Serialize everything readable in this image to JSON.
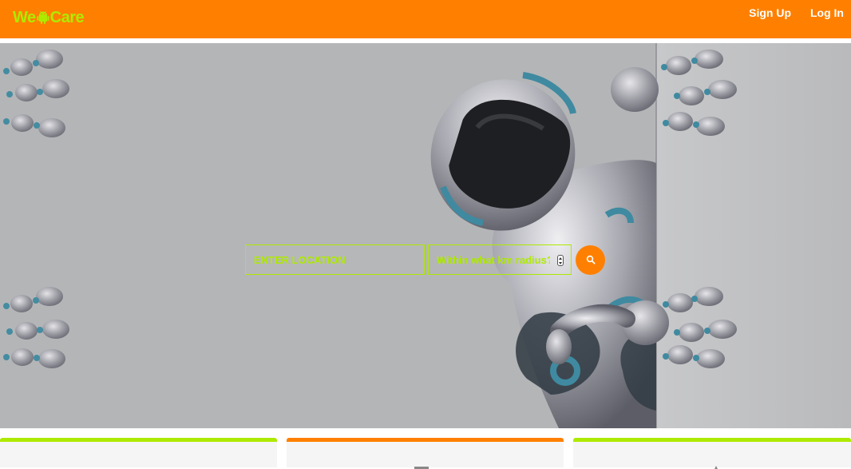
{
  "navbar": {
    "brand": {
      "prefix": "We",
      "suffix": "Care",
      "icon": "android-icon"
    },
    "links": [
      {
        "label": "Sign Up"
      },
      {
        "label": "Log In"
      }
    ]
  },
  "hero": {
    "image": "robot-peeking-icon",
    "search": {
      "location_placeholder": "ENTER LOCATION",
      "radius_placeholder": "Within what km radius?",
      "button_icon": "search-icon"
    }
  },
  "cards": [
    {
      "accent": "#aeea00"
    },
    {
      "accent": "#ff8000",
      "icon": "card-icon"
    },
    {
      "accent": "#aeea00",
      "icon": "card-icon"
    }
  ],
  "colors": {
    "brand_orange": "#ff8000",
    "brand_lime": "#aeea00",
    "hero_bg": "#b4b5b7",
    "card_bg": "#f5f5f5"
  }
}
